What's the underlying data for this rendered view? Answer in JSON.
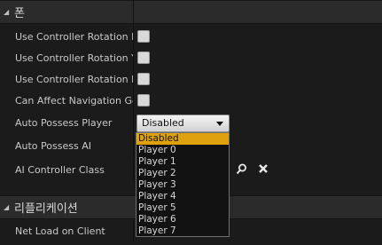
{
  "sections": [
    {
      "title": "폰"
    },
    {
      "title": "리플리케이션"
    }
  ],
  "properties": {
    "pitch": "Use Controller Rotation Pitch",
    "yaw": "Use Controller Rotation Yaw",
    "roll": "Use Controller Rotation Roll",
    "navigation": "Can Affect Navigation Generation",
    "auto_possess_player": "Auto Possess Player",
    "auto_possess_ai": "Auto Possess AI",
    "ai_controller_class": "AI Controller Class",
    "net_load_on_client": "Net Load on Client"
  },
  "auto_possess_player": {
    "selected": "Disabled",
    "options": [
      "Disabled",
      "Player 0",
      "Player 1",
      "Player 2",
      "Player 3",
      "Player 4",
      "Player 5",
      "Player 6",
      "Player 7"
    ]
  },
  "colors": {
    "selection": "#e0a10f",
    "background": "#1b1b1b",
    "header": "#2b2b2b"
  },
  "icons": [
    "search-icon",
    "close-icon",
    "collapse-arrow-icon"
  ]
}
